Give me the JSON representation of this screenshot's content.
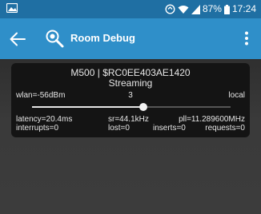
{
  "status_bar": {
    "battery_percent": "87%",
    "time": "17:24",
    "icons": [
      "notification-image-icon",
      "sync-icon",
      "wifi-icon",
      "cell-signal-icon",
      "battery-icon"
    ]
  },
  "app_bar": {
    "title": "Room Debug",
    "icons": [
      "back-arrow-icon",
      "debug-magnifier-icon",
      "overflow-menu-icon"
    ]
  },
  "device_card": {
    "title": "M500 | $RC0EE403AE1420",
    "status": "Streaming",
    "wlan": "wlan=-56dBm",
    "volume_label": "3",
    "mode": "local",
    "slider_fraction": 0.56,
    "latency": "latency=20.4ms",
    "sample_rate": "sr=44.1kHz",
    "pll": "pll=11.289600MHz",
    "interrupts": "interrupts=0",
    "lost": "lost=0",
    "inserts": "inserts=0",
    "requests": "requests=0"
  },
  "colors": {
    "status_bar": "#1f6fa3",
    "app_bar": "#2f8fc9",
    "background": "#3a3a3a",
    "card": "#141414",
    "text": "#e6e6e6"
  }
}
